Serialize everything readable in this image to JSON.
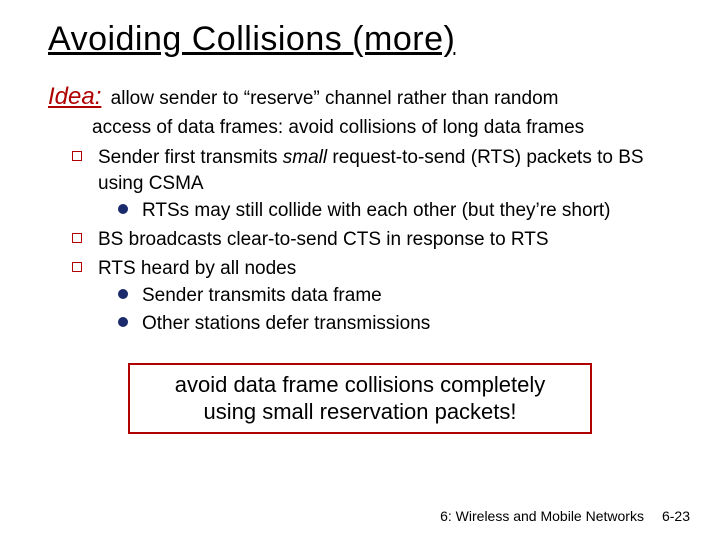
{
  "title": "Avoiding Collisions (more)",
  "idea": {
    "label": "Idea:",
    "line1": "allow sender to “reserve” channel rather than random",
    "line2": "access of data frames: avoid collisions of long data frames"
  },
  "b1": {
    "pre": "Sender first transmits ",
    "em": "small",
    "post": " request-to-send (RTS) packets to BS using CSMA",
    "sub1": "RTSs may still collide with each other (but they’re short)"
  },
  "b2": "BS broadcasts clear-to-send CTS in response to RTS",
  "b3": {
    "text": "RTS heard by all nodes",
    "sub1": "Sender transmits data frame",
    "sub2": "Other stations defer transmissions"
  },
  "callout": {
    "l1": "avoid data frame collisions completely",
    "l2": "using small reservation packets!"
  },
  "footer": {
    "chapter": "6: Wireless and Mobile Networks",
    "page": "6-23"
  }
}
